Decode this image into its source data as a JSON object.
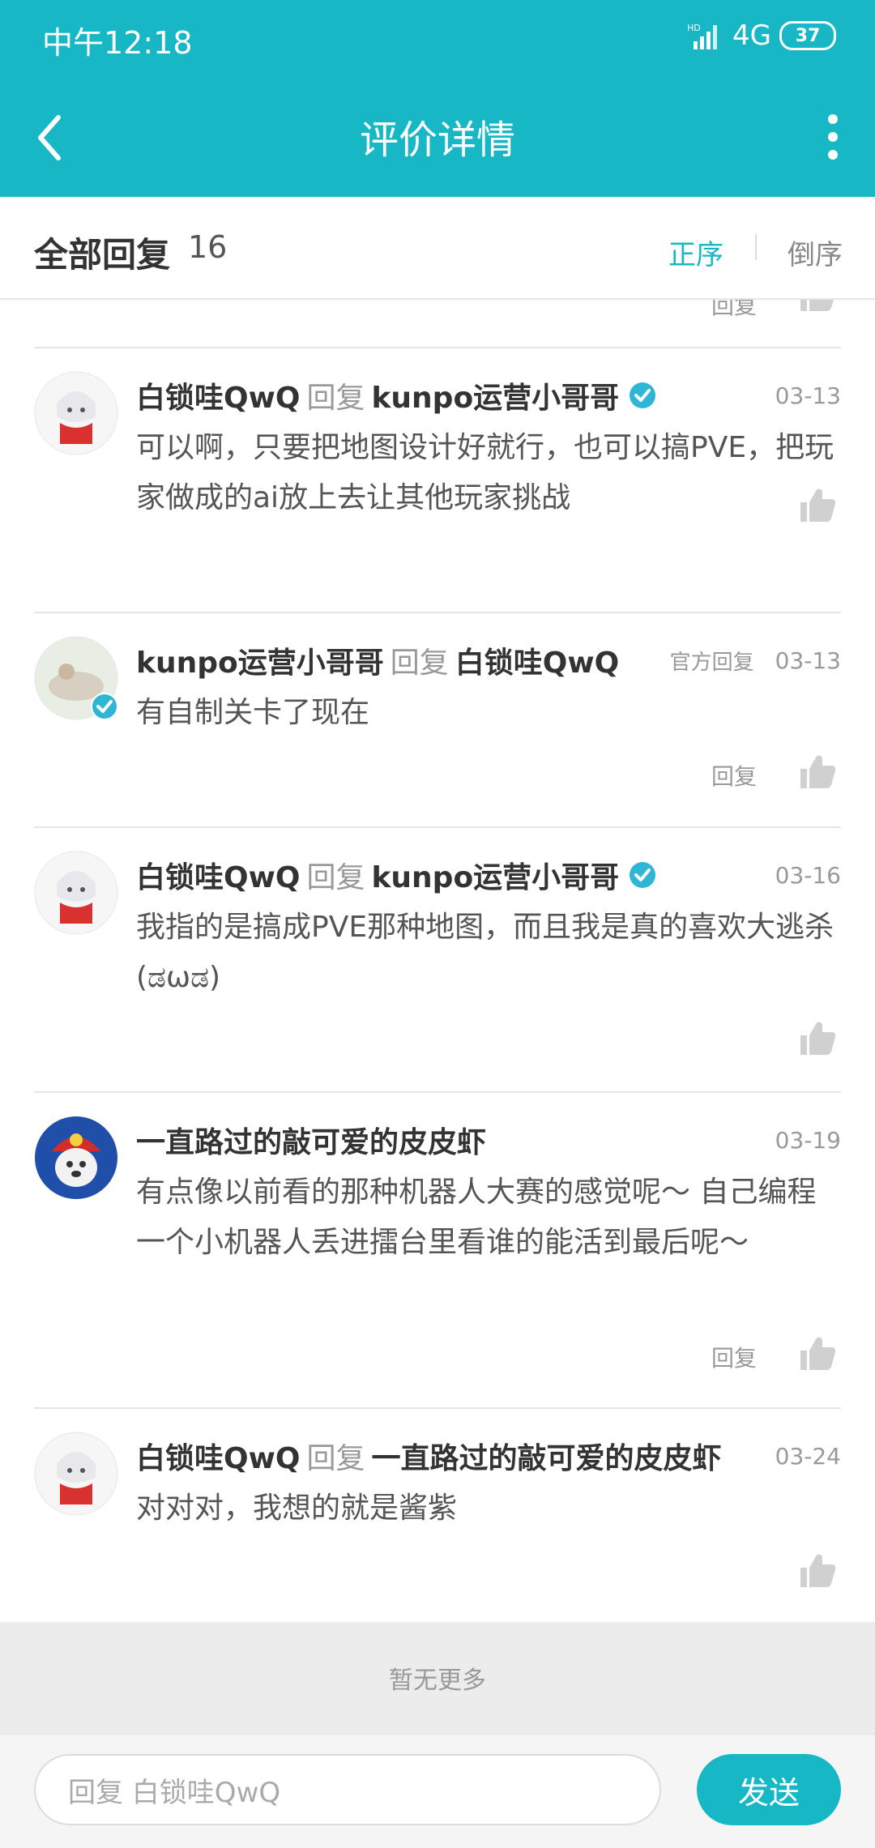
{
  "status_bar": {
    "time": "中午12:18",
    "network": "4G",
    "signal_label": "HD",
    "battery": "37"
  },
  "app_bar": {
    "title": "评价详情"
  },
  "sort_bar": {
    "label": "全部回复",
    "count": "16",
    "asc": "正序",
    "desc": "倒序"
  },
  "partial_reply": "回复",
  "comments": [
    {
      "user": "白锁哇QwQ",
      "reply_word": "回复",
      "target": "kunpo运营小哥哥",
      "target_verified": true,
      "official": "",
      "date": "03-13",
      "text": "可以啊，只要把地图设计好就行，也可以搞PVE，把玩家做成的ai放上去让其他玩家挑战",
      "reply_label": ""
    },
    {
      "user": "kunpo运营小哥哥",
      "reply_word": "回复",
      "target": "白锁哇QwQ",
      "target_verified": false,
      "official": "官方回复",
      "date": "03-13",
      "text": "有自制关卡了现在",
      "reply_label": "回复"
    },
    {
      "user": "白锁哇QwQ",
      "reply_word": "回复",
      "target": "kunpo运营小哥哥",
      "target_verified": true,
      "official": "",
      "date": "03-16",
      "text": "我指的是搞成PVE那种地图，而且我是真的喜欢大逃杀(ಡωಡ)",
      "reply_label": ""
    },
    {
      "user": "一直路过的敲可爱的皮皮虾",
      "reply_word": "",
      "target": "",
      "target_verified": false,
      "official": "",
      "date": "03-19",
      "text": "有点像以前看的那种机器人大赛的感觉呢～ 自己编程一个小机器人丢进擂台里看谁的能活到最后呢～",
      "reply_label": "回复"
    },
    {
      "user": "白锁哇QwQ",
      "reply_word": "回复",
      "target": "一直路过的敲可爱的皮皮虾",
      "target_verified": false,
      "official": "",
      "date": "03-24",
      "text": "对对对，我想的就是酱紫",
      "reply_label": ""
    }
  ],
  "footer": {
    "no_more": "暂无更多"
  },
  "input_bar": {
    "placeholder": "回复 白锁哇QwQ",
    "send": "发送"
  },
  "colors": {
    "accent": "#17b7c6",
    "verified": "#2fb6d4"
  }
}
